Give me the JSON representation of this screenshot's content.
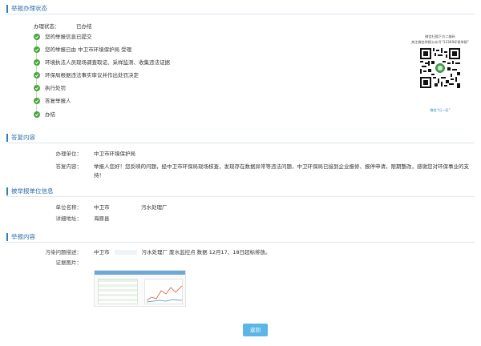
{
  "sections": {
    "status": "举报办理状态",
    "reply": "答复内容",
    "unit": "被举报单位信息",
    "content": "举报内容"
  },
  "status": {
    "label": "办理状态：",
    "value": "已办结",
    "steps": [
      "您的举报信息已提交",
      "您的举报已由 中卫市环境保护局 受理",
      "环境执法人员现场调查取证、采样监测、收集违法证据",
      "环保局根据违法事实审议并作出处罚决定",
      "执行处罚",
      "答复举报人",
      "办结"
    ]
  },
  "qr": {
    "caption_top_1": "微信扫描下方二维码",
    "caption_top_2": "关注微信举报公众号“12369环保举报”",
    "caption_bottom": "微信“扫一扫”"
  },
  "reply": {
    "unit_label": "办理单位：",
    "unit_value": "中卫市环境保护局",
    "content_label": "答复内容：",
    "content_value": "举报人您好！您反映的问题，经中卫市环保局现场核查，发现存在数据异常等违法问题，中卫环保局已接到企业报修、报停申请，限期整改，感谢您对环保事业的支持！"
  },
  "unit": {
    "name_label": "单位名称：",
    "name_city": "中卫市",
    "name_value": "污水处理厂",
    "address_label": "详细地址：",
    "address_value": "海原县"
  },
  "content": {
    "problem_label": "污染问题描述：",
    "problem_city": "中卫市",
    "problem_value": "污水处理厂 废水监控点 数据 12月17、18日超标排放。",
    "evidence_label": "证据图片："
  },
  "buttons": {
    "back": "返回"
  },
  "colors": {
    "accent": "#2f7fc0",
    "check": "#4aa63f",
    "button": "#5bb6e8"
  }
}
